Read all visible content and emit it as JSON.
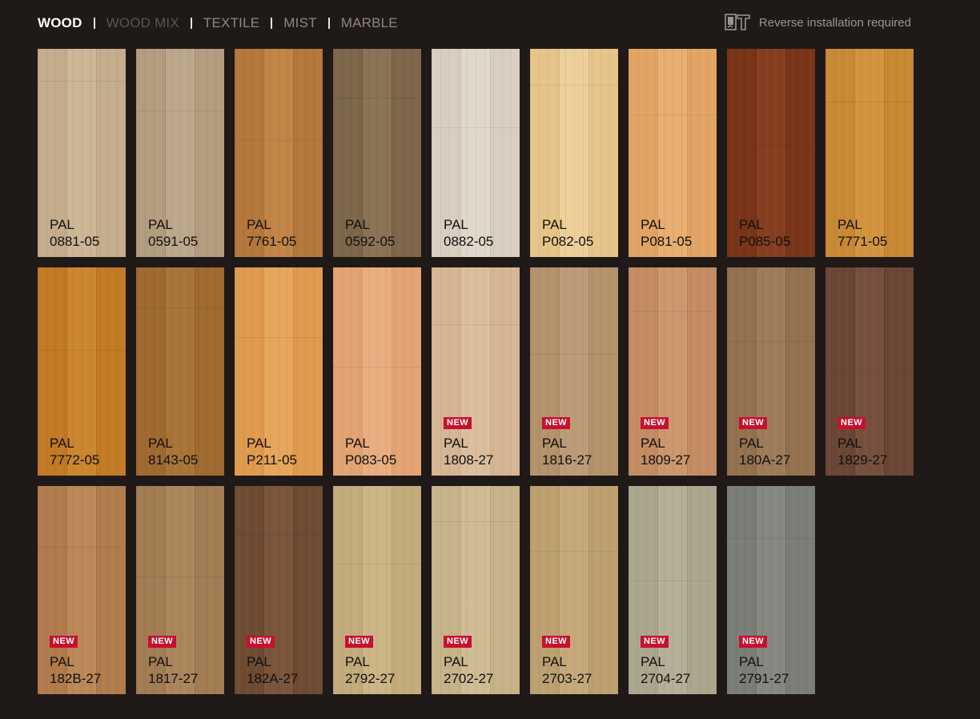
{
  "tabs": [
    {
      "label": "WOOD",
      "state": "active"
    },
    {
      "label": "WOOD MIX",
      "state": "dim"
    },
    {
      "label": "TEXTILE",
      "state": "normal"
    },
    {
      "label": "MIST",
      "state": "normal"
    },
    {
      "label": "MARBLE",
      "state": "normal"
    }
  ],
  "notice": {
    "text": "Reverse installation required",
    "icon": "reverse-installation-icon"
  },
  "badge_label": "NEW",
  "swatches": [
    {
      "code": "PAL\n0881-05",
      "new": false,
      "colors": [
        "#c3ad8c",
        "#b7a07e",
        "#cbb696"
      ]
    },
    {
      "code": "PAL\n0591-05",
      "new": false,
      "colors": [
        "#b29d7f",
        "#a18a6c",
        "#bba88c"
      ]
    },
    {
      "code": "PAL\n7761-05",
      "new": false,
      "colors": [
        "#b5783c",
        "#a86a31",
        "#c18546"
      ]
    },
    {
      "code": "PAL\n0592-05",
      "new": false,
      "colors": [
        "#7d6649",
        "#6b573d",
        "#8a7355"
      ]
    },
    {
      "code": "PAL\n0882-05",
      "new": false,
      "colors": [
        "#d8cfc0",
        "#cdc3b2",
        "#e0d8ca"
      ]
    },
    {
      "code": "PAL\nP082-05",
      "new": false,
      "colors": [
        "#e6c48a",
        "#d9b479",
        "#eccf99"
      ]
    },
    {
      "code": "PAL\nP081-05",
      "new": false,
      "colors": [
        "#e2a465",
        "#d89858",
        "#e8ae72"
      ]
    },
    {
      "code": "PAL\nP085-05",
      "new": false,
      "colors": [
        "#7a3518",
        "#6a2b12",
        "#863e20"
      ]
    },
    {
      "code": "PAL\n7771-05",
      "new": false,
      "colors": [
        "#c98934",
        "#bb7b2a",
        "#d2943f"
      ]
    },
    {
      "code": "PAL\n7772-05",
      "new": false,
      "colors": [
        "#c27a24",
        "#b56d1c",
        "#cb862f"
      ]
    },
    {
      "code": "PAL\n8143-05",
      "new": false,
      "colors": [
        "#9f6a2f",
        "#925f28",
        "#a87437"
      ]
    },
    {
      "code": "PAL\nP211-05",
      "new": false,
      "colors": [
        "#e09a4e",
        "#d48d42",
        "#e6a65c"
      ]
    },
    {
      "code": "PAL\nP083-05",
      "new": false,
      "colors": [
        "#e3a372",
        "#d89666",
        "#e9ae7f"
      ]
    },
    {
      "code": "PAL\n1808-27",
      "new": true,
      "colors": [
        "#d6b594",
        "#cba987",
        "#dcbe9f"
      ]
    },
    {
      "code": "PAL\n1816-27",
      "new": true,
      "colors": [
        "#b3926c",
        "#a58460",
        "#bc9c77"
      ]
    },
    {
      "code": "PAL\n1809-27",
      "new": true,
      "colors": [
        "#c48c63",
        "#b67f58",
        "#cc976f"
      ]
    },
    {
      "code": "PAL\n180A-27",
      "new": true,
      "colors": [
        "#94714f",
        "#856447",
        "#9e7b59"
      ]
    },
    {
      "code": "PAL\n1829-27",
      "new": true,
      "colors": [
        "#6b4634",
        "#5d3c2c",
        "#76503d"
      ]
    },
    {
      "code": "PAL\n182B-27",
      "new": true,
      "colors": [
        "#b07c4c",
        "#a06e41",
        "#bb8857"
      ]
    },
    {
      "code": "PAL\n1817-27",
      "new": true,
      "colors": [
        "#a27c53",
        "#93704a",
        "#ab865d"
      ]
    },
    {
      "code": "PAL\n182A-27",
      "new": true,
      "colors": [
        "#6f4b33",
        "#613f2a",
        "#7a553c"
      ]
    },
    {
      "code": "PAL\n2792-27",
      "new": true,
      "colors": [
        "#c3ab7b",
        "#b59d6f",
        "#cbb486"
      ]
    },
    {
      "code": "PAL\n2702-27",
      "new": true,
      "colors": [
        "#c6b389",
        "#b9a67d",
        "#cfbc94"
      ]
    },
    {
      "code": "PAL\n2703-27",
      "new": true,
      "colors": [
        "#bda070",
        "#b09364",
        "#c5a97b"
      ]
    },
    {
      "code": "PAL\n2704-27",
      "new": true,
      "colors": [
        "#aca68f",
        "#9f9983",
        "#b5af99"
      ]
    },
    {
      "code": "PAL\n2791-27",
      "new": true,
      "colors": [
        "#7b7d77",
        "#6e706a",
        "#858781"
      ]
    }
  ]
}
